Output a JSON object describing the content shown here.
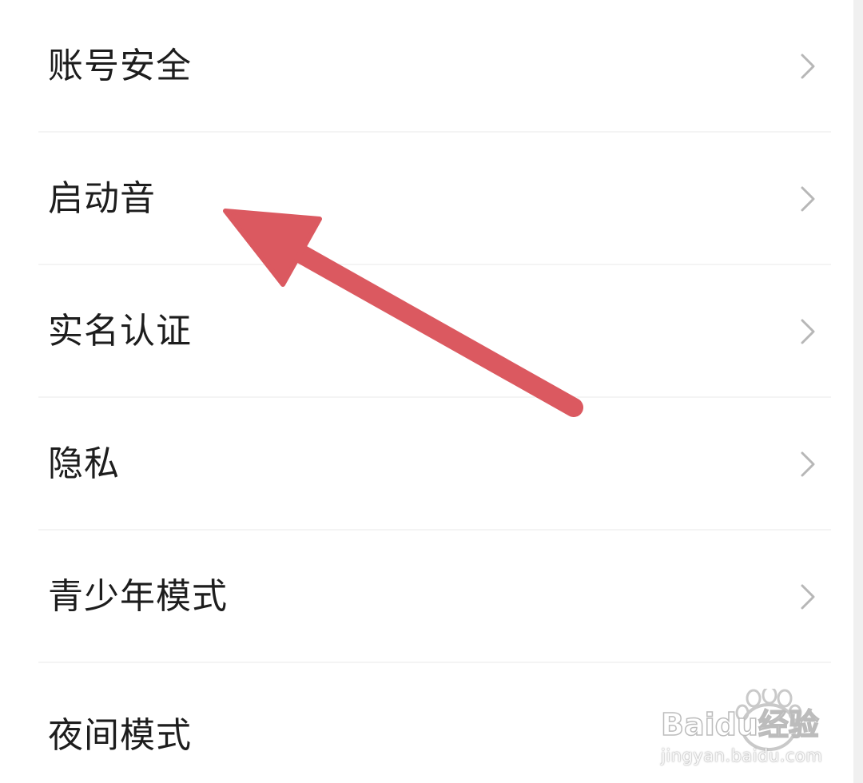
{
  "settings": {
    "items": [
      {
        "label": "账号安全",
        "icon": "chevron-right-icon"
      },
      {
        "label": "启动音",
        "icon": "chevron-right-icon"
      },
      {
        "label": "实名认证",
        "icon": "chevron-right-icon"
      },
      {
        "label": "隐私",
        "icon": "chevron-right-icon"
      },
      {
        "label": "青少年模式",
        "icon": "chevron-right-icon"
      },
      {
        "label": "夜间模式",
        "icon": "chevron-right-icon"
      }
    ]
  },
  "annotation": {
    "type": "arrow",
    "color": "#db5960"
  },
  "watermark": {
    "brand": "Baidu经验",
    "url": "jingyan.baidu.com"
  }
}
